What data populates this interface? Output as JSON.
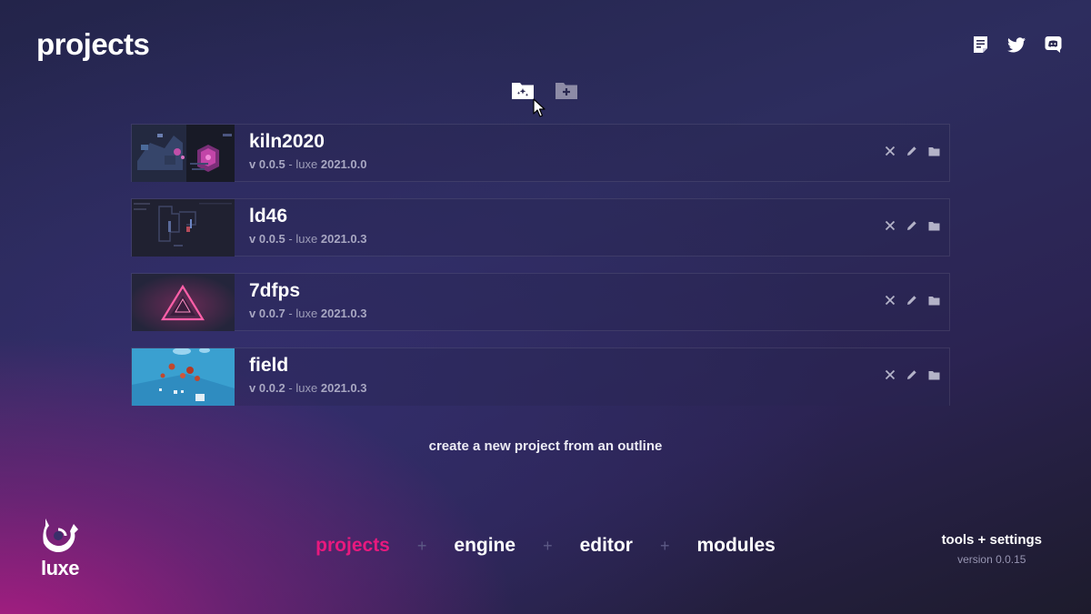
{
  "page": {
    "title": "projects"
  },
  "top_icons": [
    {
      "name": "notes-icon"
    },
    {
      "name": "twitter-icon"
    },
    {
      "name": "discord-icon"
    }
  ],
  "folder_actions": [
    {
      "name": "new-project-folder-icon"
    },
    {
      "name": "add-folder-icon"
    }
  ],
  "projects": [
    {
      "name": "kiln2020",
      "version_prefix": "v",
      "version": "0.0.5",
      "sep": "-",
      "engine_label": "luxe",
      "engine_version": "2021.0.0",
      "thumb_style": "kiln"
    },
    {
      "name": "ld46",
      "version_prefix": "v",
      "version": "0.0.5",
      "sep": "-",
      "engine_label": "luxe",
      "engine_version": "2021.0.3",
      "thumb_style": "ld46"
    },
    {
      "name": "7dfps",
      "version_prefix": "v",
      "version": "0.0.7",
      "sep": "-",
      "engine_label": "luxe",
      "engine_version": "2021.0.3",
      "thumb_style": "7dfps"
    },
    {
      "name": "field",
      "version_prefix": "v",
      "version": "0.0.2",
      "sep": "-",
      "engine_label": "luxe",
      "engine_version": "2021.0.3",
      "thumb_style": "field"
    }
  ],
  "create_link": "create a new project from an outline",
  "logo": {
    "text": "luxe"
  },
  "nav": {
    "items": [
      "projects",
      "engine",
      "editor",
      "modules"
    ],
    "active": "projects",
    "separator": "+"
  },
  "tools": {
    "label": "tools + settings",
    "version": "version 0.0.15"
  },
  "colors": {
    "accent": "#e8197e",
    "text": "#ffffff",
    "muted": "#9d9cb8"
  }
}
